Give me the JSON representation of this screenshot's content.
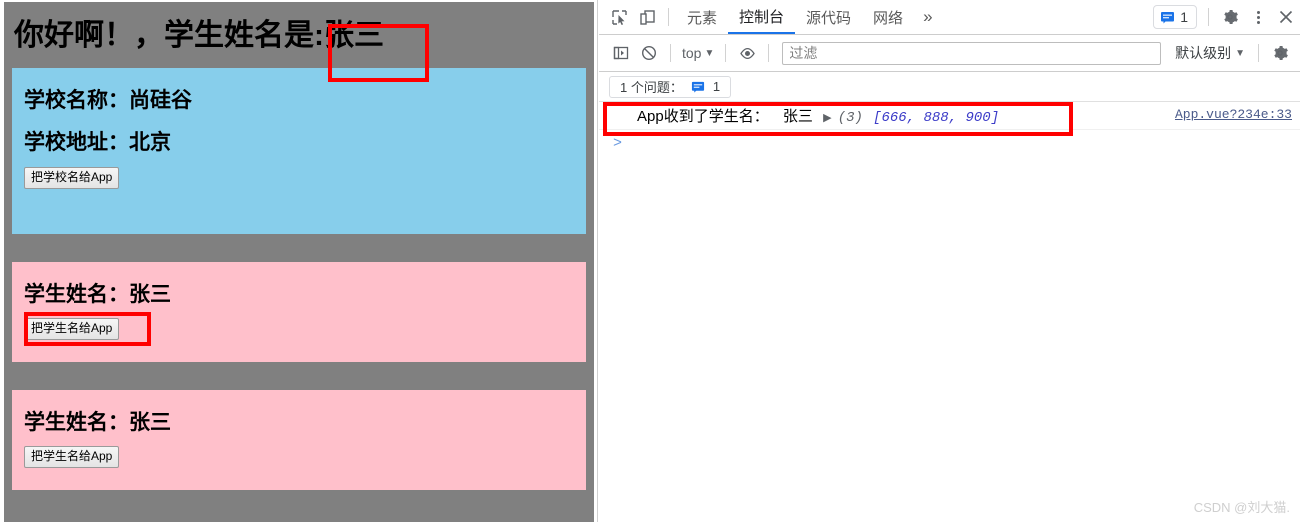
{
  "page": {
    "greeting_prefix": "你好啊！",
    "title": "你好啊！，学生姓名是:张三",
    "school_card": {
      "name_line": "学校名称：尚硅谷",
      "address_line": "学校地址：北京",
      "button_label": "把学校名给App"
    },
    "student_card_1": {
      "name_line": "学生姓名：张三",
      "button_label": "把学生名给App"
    },
    "student_card_2": {
      "name_line": "学生姓名：张三",
      "button_label": "把学生名给App"
    },
    "colors": {
      "background": "#808080",
      "school_card": "#87ceeb",
      "student_card": "#ffc0cb",
      "highlight_box": "#ff0000"
    }
  },
  "devtools": {
    "tabs": [
      {
        "label": "元素",
        "active": false
      },
      {
        "label": "控制台",
        "active": true
      },
      {
        "label": "源代码",
        "active": false
      },
      {
        "label": "网络",
        "active": false
      }
    ],
    "more_tabs_label": "»",
    "issue_badge_count": "1",
    "console_toolbar": {
      "context_label": "top",
      "caret": "▼",
      "filter_placeholder": "过滤",
      "filter_value": "",
      "levels_label": "默认级别",
      "levels_caret": "▼"
    },
    "issue_bar": {
      "text": "1 个问题：",
      "count": "1"
    },
    "console_logs": [
      {
        "message_prefix": "App收到了学生名：",
        "message_value": "张三",
        "expand_arrow": "▶",
        "array_length": "(3)",
        "array_value": "[666, 888, 900]",
        "source": "App.vue?234e:33"
      }
    ],
    "prompt_symbol": ">",
    "accent_color": "#1a73e8"
  },
  "watermark": "CSDN @刘大猫."
}
